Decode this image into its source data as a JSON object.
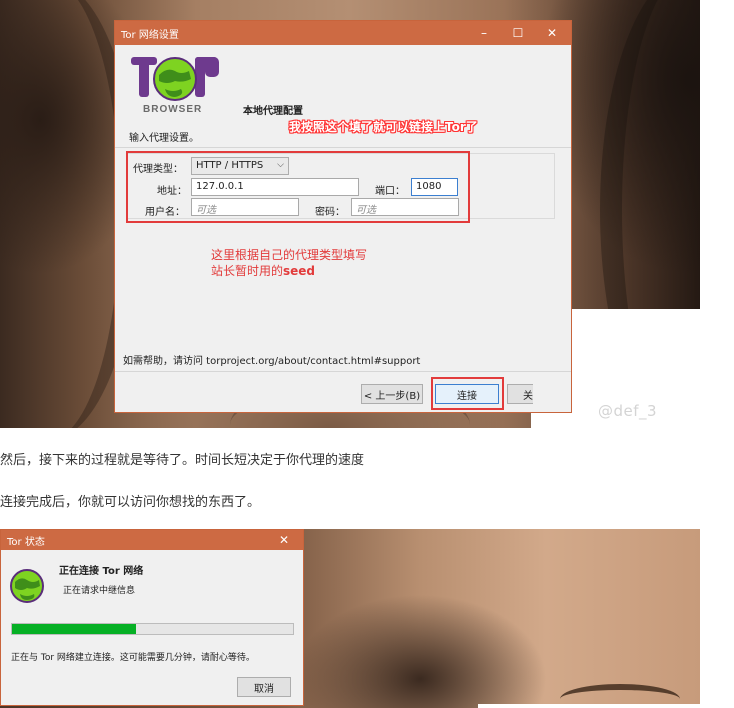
{
  "screenshot1": {
    "window_title": "Tor 网络设置",
    "window_controls": {
      "minimize": "–",
      "maximize": "☐",
      "close": "✕"
    },
    "logo_text": "BROWSER",
    "header_title": "本地代理配置",
    "annotation_top": "我按照这个填了就可以链接上Tor了",
    "subtitle": "输入代理设置。",
    "proxy_type_label": "代理类型：",
    "proxy_type_value": "HTTP / HTTPS",
    "address_label": "地址：",
    "address_value": "127.0.0.1",
    "port_label": "端口：",
    "port_value": "1080",
    "username_label": "用户名：",
    "username_placeholder": "可选",
    "password_label": "密码：",
    "password_placeholder": "可选",
    "annotation_line1": "这里根据自己的代理类型填写",
    "annotation_line2_prefix": "站长暂时用的",
    "annotation_line2_bold": "seed",
    "help_text": "如需帮助，请访问 torproject.org/about/contact.html#support",
    "back_button": "< 上一步(B)",
    "connect_button": "连接",
    "close_button_partial": "关",
    "watermark": "@def_3",
    "colors": {
      "titlebar": "#cd6a43",
      "annotation_red": "#e23b3b",
      "focus_blue": "#3c7fd0"
    }
  },
  "article": {
    "para1": "然后，接下来的过程就是等待了。时间长短决定于你代理的速度",
    "para2": "连接完成后，你就可以访问你想找的东西了。"
  },
  "screenshot2": {
    "window_title": "Tor 状态",
    "close": "✕",
    "status_title": "正在连接 Tor 网络",
    "status_sub": "正在请求中继信息",
    "progress": 0.44,
    "message": "正在与 Tor 网络建立连接。这可能需要几分钟，请耐心等待。",
    "cancel_button": "取消",
    "progress_color": "#06b025"
  }
}
